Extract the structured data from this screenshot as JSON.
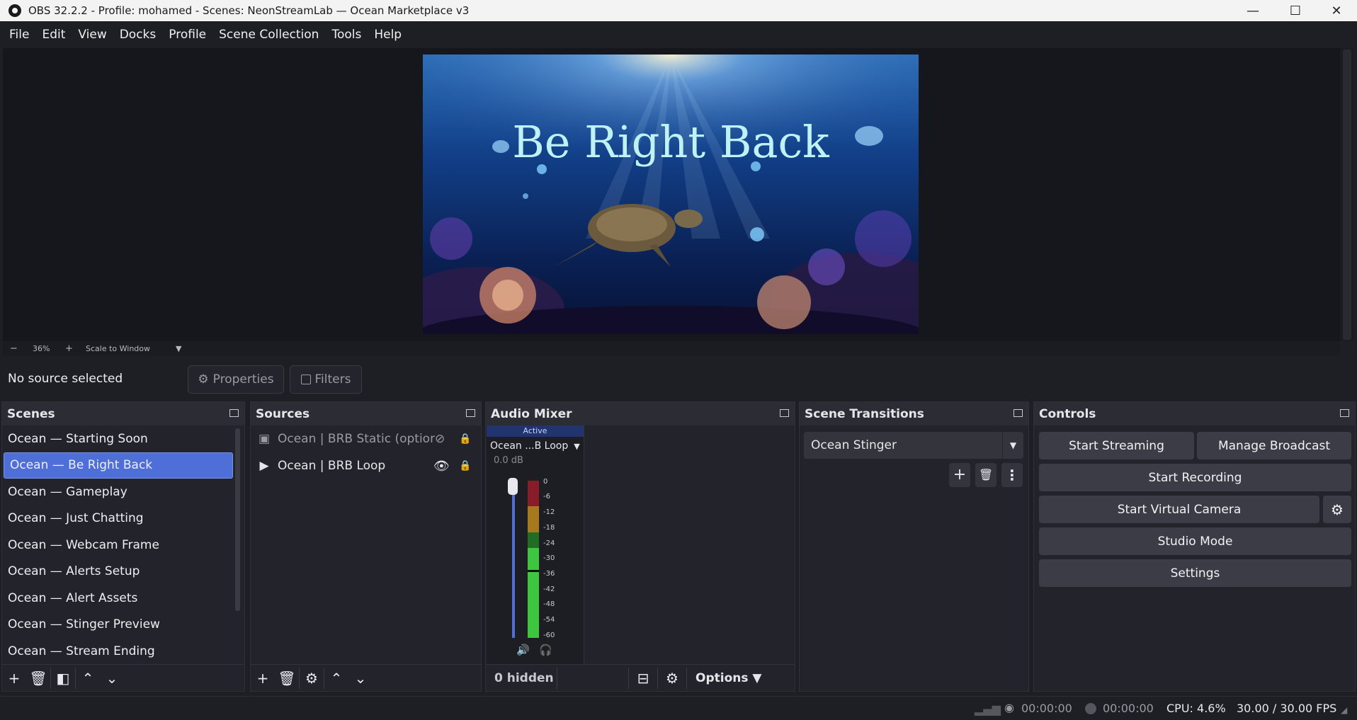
{
  "window": {
    "title": "OBS 32.2.2 - Profile: mohamed - Scenes: NeonStreamLab — Ocean Marketplace v3",
    "minimize": "—",
    "maximize": "☐",
    "close": "✕"
  },
  "menu": [
    "File",
    "Edit",
    "View",
    "Docks",
    "Profile",
    "Scene Collection",
    "Tools",
    "Help"
  ],
  "preview": {
    "image_text": "Be Right Back",
    "zoom_minus": "−",
    "zoom_level": "36%",
    "zoom_plus": "+",
    "scale_mode": "Scale to Window"
  },
  "props_bar": {
    "status": "No source selected",
    "properties": "Properties",
    "filters": "Filters"
  },
  "scenes": {
    "title": "Scenes",
    "items": [
      "Ocean — Starting Soon",
      "Ocean — Be Right Back",
      "Ocean — Gameplay",
      "Ocean — Just Chatting",
      "Ocean — Webcam Frame",
      "Ocean — Alerts Setup",
      "Ocean — Alert Assets",
      "Ocean — Stinger Preview",
      "Ocean — Stream Ending"
    ],
    "selected_index": 1
  },
  "sources": {
    "title": "Sources",
    "items": [
      {
        "name": "Ocean | BRB Static (optional",
        "type": "image",
        "visible": false,
        "locked": true
      },
      {
        "name": "Ocean | BRB Loop",
        "type": "media",
        "visible": true,
        "locked": true
      }
    ]
  },
  "audio": {
    "title": "Audio Mixer",
    "active_label": "Active",
    "channel": "Ocean ...B Loop",
    "volume": "0.0 dB",
    "ticks": [
      "0",
      "-6",
      "-12",
      "-18",
      "-24",
      "-30",
      "-36",
      "-42",
      "-48",
      "-54",
      "-60"
    ],
    "hidden": "0 hidden",
    "options": "Options"
  },
  "transitions": {
    "title": "Scene Transitions",
    "selected": "Ocean Stinger"
  },
  "controls": {
    "title": "Controls",
    "start_streaming": "Start Streaming",
    "manage_broadcast": "Manage Broadcast",
    "start_recording": "Start Recording",
    "start_virtual_camera": "Start Virtual Camera",
    "studio_mode": "Studio Mode",
    "settings": "Settings"
  },
  "status": {
    "stream_time": "00:00:00",
    "record_time": "00:00:00",
    "cpu": "CPU: 4.6%",
    "fps": "30.00 / 30.00 FPS"
  },
  "colors": {
    "accent": "#4f6fd8",
    "meter_green": "#3ec63e",
    "meter_yellow": "#a8791a",
    "meter_red": "#8a1c2a",
    "volume_slider": "#4f6fd8"
  }
}
